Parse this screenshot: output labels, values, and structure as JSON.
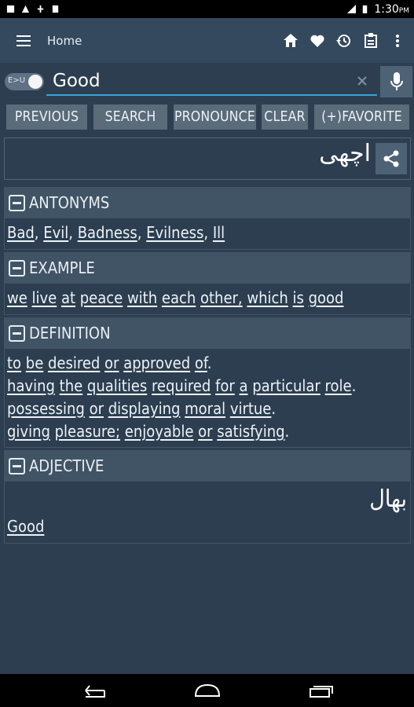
{
  "status": {
    "time": "1:30",
    "ampm": "PM"
  },
  "appbar": {
    "title": "Home"
  },
  "search": {
    "toggle_label": "E>U",
    "query": "Good"
  },
  "buttons": {
    "previous": "PREVIOUS",
    "search": "SEARCH",
    "pronounce": "PRONOUNCE",
    "clear": "CLEAR",
    "favorite": "(+)FAVORITE"
  },
  "result": {
    "urdu": "اچھی"
  },
  "antonyms": {
    "title": "ANTONYMS",
    "items": [
      "Bad",
      "Evil",
      "Badness",
      "Evilness",
      "Ill"
    ]
  },
  "example": {
    "title": "EXAMPLE",
    "words": [
      "we",
      "live",
      "at",
      "peace",
      "with",
      "each",
      "other,",
      "which",
      "is",
      "good"
    ]
  },
  "definition": {
    "title": "DEFINITION",
    "lines": [
      {
        "words": [
          "to",
          "be",
          "desired",
          "or",
          "approved",
          "of"
        ],
        "end": "."
      },
      {
        "words": [
          "having",
          "the",
          "qualities",
          "required",
          "for",
          "a",
          "particular",
          "role"
        ],
        "end": "."
      },
      {
        "words": [
          "possessing",
          "or",
          "displaying",
          "moral",
          "virtue"
        ],
        "end": "."
      },
      {
        "words": [
          "giving",
          "pleasure;",
          "enjoyable",
          "or",
          "satisfying"
        ],
        "end": "."
      }
    ]
  },
  "adjective": {
    "title": "ADJECTIVE",
    "urdu": "بھال",
    "word": "Good"
  },
  "colors": {
    "accent": "#3aa3d8",
    "background": "#2c3e50",
    "appbar": "#34495e",
    "button": "#5a6b7a"
  }
}
